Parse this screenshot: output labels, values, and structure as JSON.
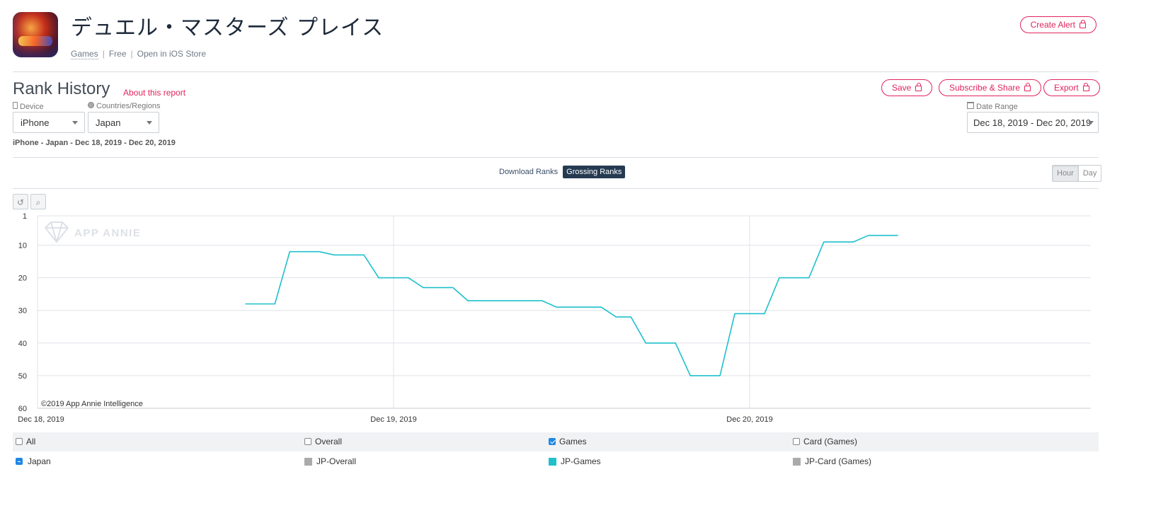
{
  "app": {
    "title": "デュエル・マスターズ プレイス",
    "category": "Games",
    "price": "Free",
    "store_link": "Open in iOS Store",
    "create_alert": "Create Alert"
  },
  "report": {
    "title": "Rank History",
    "about": "About this report",
    "save": "Save",
    "subscribe": "Subscribe & Share",
    "export": "Export",
    "device_label": "Device",
    "device_value": "iPhone",
    "country_label": "Countries/Regions",
    "country_value": "Japan",
    "date_range_label": "Date Range",
    "date_range_value": "Dec 18, 2019 - Dec 20, 2019",
    "subtitle": "iPhone - Japan - Dec 18, 2019 - Dec 20, 2019"
  },
  "tabs": {
    "download": "Download Ranks",
    "grossing": "Grossing Ranks",
    "active": "grossing"
  },
  "granularity": {
    "hour": "Hour",
    "day": "Day",
    "selected": "Hour"
  },
  "tools": {
    "reset_icon": "reset-icon",
    "zoom_icon": "zoom-icon"
  },
  "chart_data": {
    "type": "line",
    "watermark": "APP ANNIE",
    "copyright": "©2019 App Annie Intelligence",
    "y_reversed": true,
    "yticks": [
      1,
      10,
      20,
      30,
      40,
      50,
      60
    ],
    "ylim": [
      1,
      60
    ],
    "xticks": [
      "Dec 18, 2019",
      "Dec 19, 2019",
      "Dec 20, 2019"
    ],
    "x_unit": "hours from Dec 18, 2019 00:00",
    "xlim": [
      0,
      71
    ],
    "grid": true,
    "line_color": "#1fc0cc",
    "series": [
      {
        "name": "JP-Games",
        "points": [
          [
            14,
            28
          ],
          [
            16,
            28
          ],
          [
            17,
            12
          ],
          [
            19,
            12
          ],
          [
            20,
            13
          ],
          [
            22,
            13
          ],
          [
            23,
            20
          ],
          [
            25,
            20
          ],
          [
            26,
            23
          ],
          [
            28,
            23
          ],
          [
            29,
            27
          ],
          [
            34,
            27
          ],
          [
            35,
            29
          ],
          [
            38,
            29
          ],
          [
            39,
            32
          ],
          [
            40,
            32
          ],
          [
            41,
            40
          ],
          [
            43,
            40
          ],
          [
            44,
            50
          ],
          [
            46,
            50
          ],
          [
            47,
            31
          ],
          [
            49,
            31
          ],
          [
            50,
            20
          ],
          [
            52,
            20
          ],
          [
            53,
            9
          ],
          [
            55,
            9
          ],
          [
            56,
            7
          ],
          [
            58,
            7
          ]
        ]
      }
    ]
  },
  "legend": {
    "filters": [
      {
        "label": "All",
        "checked": false
      },
      {
        "label": "Overall",
        "checked": false
      },
      {
        "label": "Games",
        "checked": true
      },
      {
        "label": "Card (Games)",
        "checked": false
      }
    ],
    "series": [
      {
        "label": "Japan",
        "style": "minus"
      },
      {
        "label": "JP-Overall",
        "color": "#aaaaaa"
      },
      {
        "label": "JP-Games",
        "color": "#1fc0cc"
      },
      {
        "label": "JP-Card (Games)",
        "color": "#aaaaaa"
      }
    ]
  }
}
